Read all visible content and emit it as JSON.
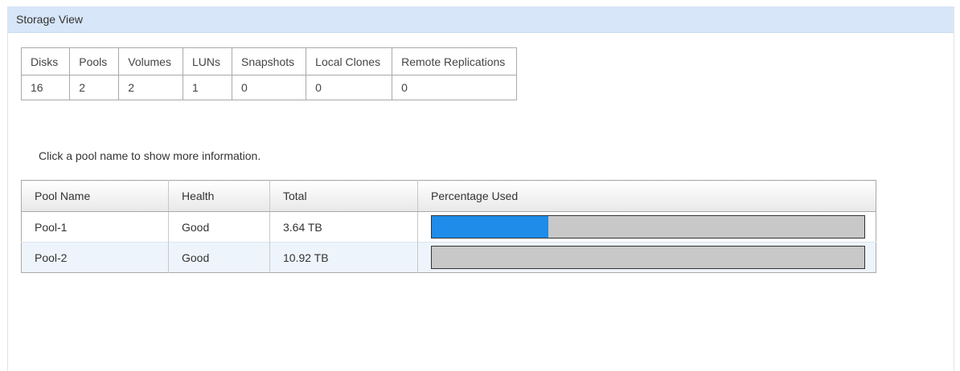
{
  "panel": {
    "title": "Storage View"
  },
  "summary": {
    "headers": [
      "Disks",
      "Pools",
      "Volumes",
      "LUNs",
      "Snapshots",
      "Local Clones",
      "Remote Replications"
    ],
    "values": [
      "16",
      "2",
      "2",
      "1",
      "0",
      "0",
      "0"
    ]
  },
  "hint": "Click a pool name to show more information.",
  "pools": {
    "headers": [
      "Pool Name",
      "Health",
      "Total",
      "Percentage Used"
    ],
    "rows": [
      {
        "name": "Pool-1",
        "health": "Good",
        "total": "3.64 TB",
        "used_fraction": 0.27
      },
      {
        "name": "Pool-2",
        "health": "Good",
        "total": "10.92 TB",
        "used_fraction": 0.0
      }
    ]
  },
  "colors": {
    "header_bg": "#d7e6f9",
    "bar_fill": "#1e8ce8",
    "bar_bg": "#c8c8c8",
    "health_good": "#2e8b2e"
  }
}
